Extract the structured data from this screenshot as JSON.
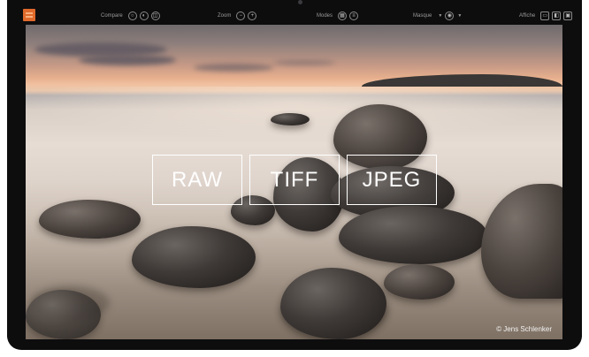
{
  "toolbar": {
    "groups": [
      {
        "label": "Compare",
        "buttons": [
          "circle-icon",
          "compare-icon",
          "split-icon"
        ]
      },
      {
        "label": "Zoom",
        "buttons": [
          "minus-icon",
          "plus-icon"
        ]
      },
      {
        "label": "Modes",
        "buttons": [
          "grid-icon",
          "list-icon"
        ]
      },
      {
        "label": "Masque",
        "buttons": [
          "mask-icon"
        ]
      },
      {
        "label": "Affiche",
        "buttons": [
          "window-icon",
          "panel-icon",
          "fullscreen-icon"
        ]
      }
    ]
  },
  "formats": [
    "RAW",
    "TIFF",
    "JPEG"
  ],
  "credit": "© Jens Schlenker",
  "colors": {
    "accent": "#e06a2b",
    "bezel": "#0d0d0e"
  }
}
